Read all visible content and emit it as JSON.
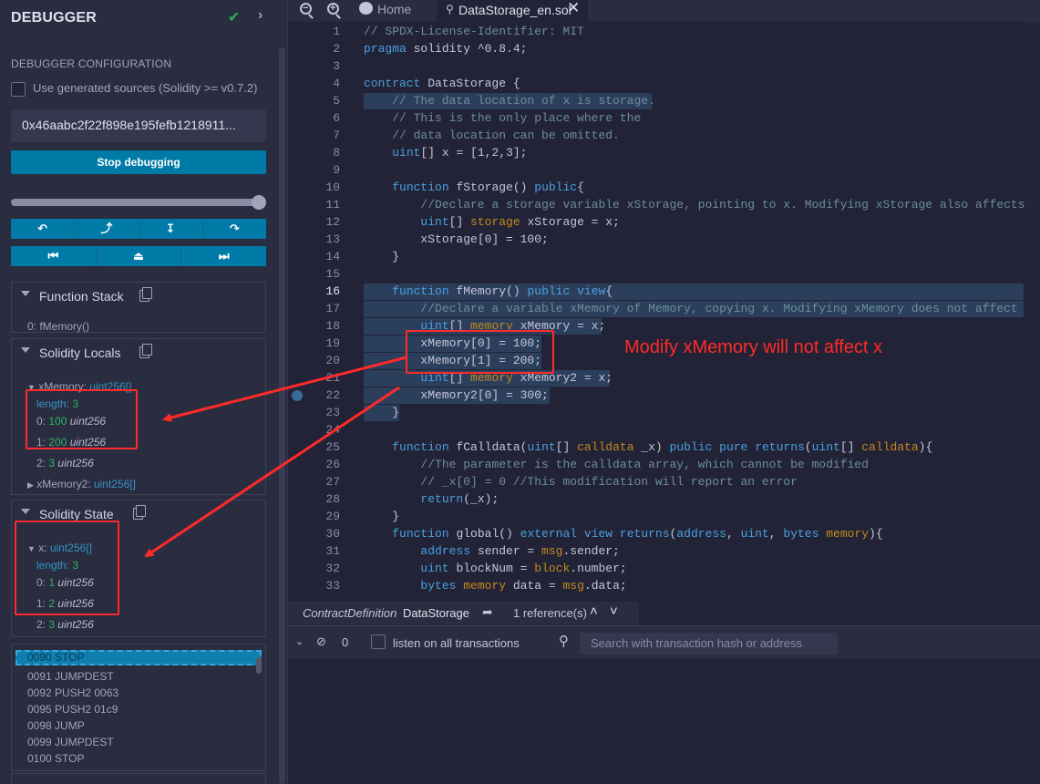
{
  "debugger": {
    "title": "DEBUGGER",
    "config_title": "DEBUGGER CONFIGURATION",
    "generated_sources_label": "Use generated sources (Solidity >= v0.7.2)",
    "tx_hash": "0x46aabc2f22f898e195fefb1218911...",
    "stop_label": "Stop debugging"
  },
  "function_stack": {
    "title": "Function Stack",
    "item": "0: fMemory()"
  },
  "locals": {
    "title": "Solidity Locals",
    "xMemory_name": "xMemory:",
    "xMemory_type": "uint256[]",
    "length_label": "length:",
    "length_value": "3",
    "items": [
      {
        "idx": "0:",
        "val": "100",
        "type": "uint256"
      },
      {
        "idx": "1:",
        "val": "200",
        "type": "uint256"
      },
      {
        "idx": "2:",
        "val": "3",
        "type": "uint256"
      }
    ],
    "xMemory2_name": "xMemory2:",
    "xMemory2_type": "uint256[]"
  },
  "state": {
    "title": "Solidity State",
    "x_name": "x:",
    "x_type": "uint256[]",
    "length_label": "length:",
    "length_value": "3",
    "items": [
      {
        "idx": "0:",
        "val": "1",
        "type": "uint256"
      },
      {
        "idx": "1:",
        "val": "2",
        "type": "uint256"
      },
      {
        "idx": "2:",
        "val": "3",
        "type": "uint256"
      }
    ]
  },
  "opcodes": [
    "0090 STOP",
    "0091 JUMPDEST",
    "0092 PUSH2 0063",
    "0095 PUSH2 01c9",
    "0098 JUMP",
    "0099 JUMPDEST",
    "0100 STOP"
  ],
  "tabs": {
    "home": "Home",
    "file": "DataStorage_en.sol"
  },
  "editor": {
    "lines": [
      "// SPDX-License-Identifier: MIT",
      "pragma solidity ^0.8.4;",
      "",
      "contract DataStorage {",
      "    // The data location of x is storage.",
      "    // This is the only place where the",
      "    // data location can be omitted.",
      "    uint[] x = [1,2,3];",
      "",
      "    function fStorage() public{",
      "        //Declare a storage variable xStorage, pointing to x. Modifying xStorage also affects x",
      "        uint[] storage xStorage = x;",
      "        xStorage[0] = 100;",
      "    }",
      "",
      "    function fMemory() public view{",
      "        //Declare a variable xMemory of Memory, copying x. Modifying xMemory does not affect x",
      "        uint[] memory xMemory = x;",
      "        xMemory[0] = 100;",
      "        xMemory[1] = 200;",
      "        uint[] memory xMemory2 = x;",
      "        xMemory2[0] = 300;",
      "    }",
      "",
      "    function fCalldata(uint[] calldata _x) public pure returns(uint[] calldata){",
      "        //The parameter is the calldata array, which cannot be modified",
      "        // _x[0] = 0 //This modification will report an error",
      "        return(_x);",
      "    }",
      "    function global() external view returns(address, uint, bytes memory){",
      "        address sender = msg.sender;",
      "        uint blockNum = block.number;",
      "        bytes memory data = msg.data;"
    ],
    "current_line": 16
  },
  "refbar": {
    "kind": "ContractDefinition",
    "name": "DataStorage",
    "refs": "1 reference(s)"
  },
  "terminal": {
    "count": "0",
    "listen_label": "listen on all transactions",
    "search_placeholder": "Search with transaction hash or address"
  },
  "annotation": {
    "text": "Modify xMemory will not affect x",
    "color": "#ff2a2a"
  }
}
